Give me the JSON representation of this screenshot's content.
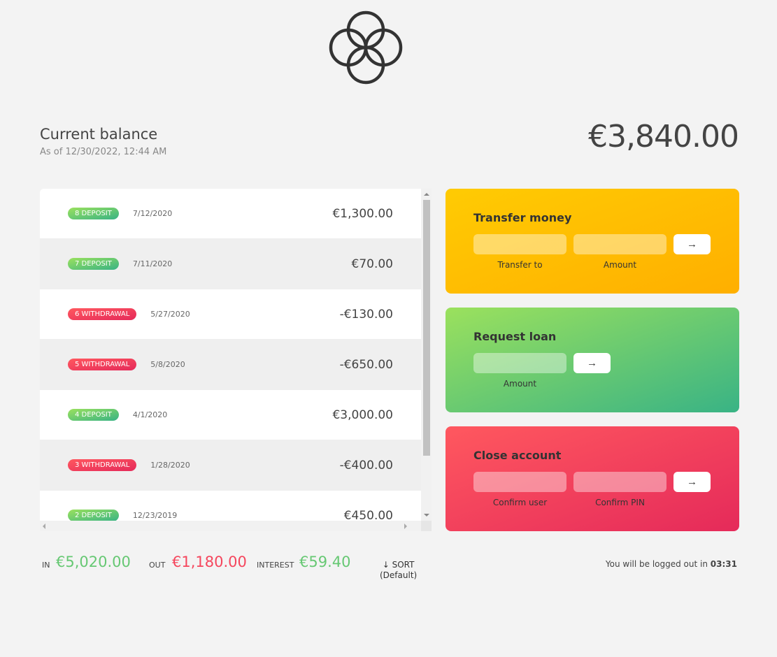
{
  "header": {
    "logo_icon": "interlocking-rings-logo"
  },
  "balance": {
    "title": "Current balance",
    "date": "As of 12/30/2022, 12:44 AM",
    "value": "€3,840.00"
  },
  "movements": [
    {
      "type": "deposit",
      "label": "8 DEPOSIT",
      "date": "7/12/2020",
      "value": "€1,300.00"
    },
    {
      "type": "deposit",
      "label": "7 DEPOSIT",
      "date": "7/11/2020",
      "value": "€70.00"
    },
    {
      "type": "withdrawal",
      "label": "6 WITHDRAWAL",
      "date": "5/27/2020",
      "value": "-€130.00"
    },
    {
      "type": "withdrawal",
      "label": "5 WITHDRAWAL",
      "date": "5/8/2020",
      "value": "-€650.00"
    },
    {
      "type": "deposit",
      "label": "4 DEPOSIT",
      "date": "4/1/2020",
      "value": "€3,000.00"
    },
    {
      "type": "withdrawal",
      "label": "3 WITHDRAWAL",
      "date": "1/28/2020",
      "value": "-€400.00"
    },
    {
      "type": "deposit",
      "label": "2 DEPOSIT",
      "date": "12/23/2019",
      "value": "€450.00"
    }
  ],
  "operations": {
    "transfer": {
      "title": "Transfer money",
      "to_label": "Transfer to",
      "amount_label": "Amount",
      "button": "→"
    },
    "loan": {
      "title": "Request loan",
      "amount_label": "Amount",
      "button": "→"
    },
    "close": {
      "title": "Close account",
      "user_label": "Confirm user",
      "pin_label": "Confirm PIN",
      "button": "→"
    }
  },
  "summary": {
    "in_label": "In",
    "in_value": "€5,020.00",
    "out_label": "Out",
    "out_value": "€1,180.00",
    "interest_label": "Interest",
    "interest_value": "€59.40",
    "sort_label": "↓ SORT",
    "sort_state": "(Default)"
  },
  "logout": {
    "text": "You will be logged out in",
    "timer": "03:31"
  },
  "colors": {
    "deposit": "#66c873",
    "withdrawal": "#f5465d",
    "transfer": "#ffb003",
    "loan": "#39b385",
    "close": "#e52a5a"
  }
}
